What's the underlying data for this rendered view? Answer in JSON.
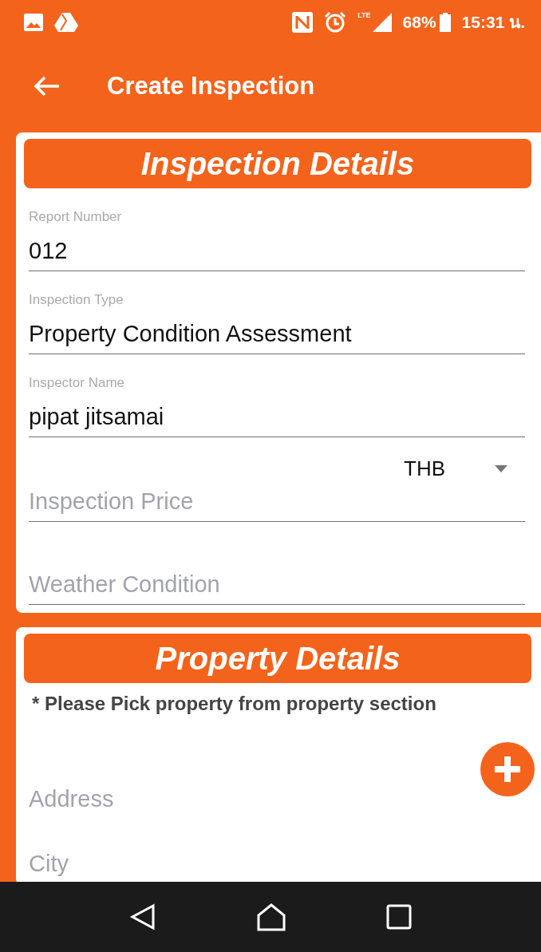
{
  "status_bar": {
    "network": "LTE",
    "battery": "68%",
    "time": "15:31 น."
  },
  "app_bar": {
    "title": "Create Inspection"
  },
  "sections": [
    {
      "title": "Inspection Details",
      "fields": [
        {
          "kind": "filled",
          "label": "Report Number",
          "value": "012"
        },
        {
          "kind": "filled",
          "label": "Inspection Type",
          "value": "Property Condition Assessment"
        },
        {
          "kind": "filled",
          "label": "Inspector Name",
          "value": "pipat jitsamai"
        },
        {
          "kind": "price",
          "placeholder": "Inspection Price",
          "currency": "THB"
        },
        {
          "kind": "empty",
          "placeholder": "Weather Condition"
        }
      ]
    },
    {
      "title": "Property Details",
      "note": "* Please Pick property from property section",
      "fields": [
        {
          "kind": "add",
          "placeholder": "Address"
        },
        {
          "kind": "bare",
          "placeholder": "City"
        }
      ]
    }
  ]
}
